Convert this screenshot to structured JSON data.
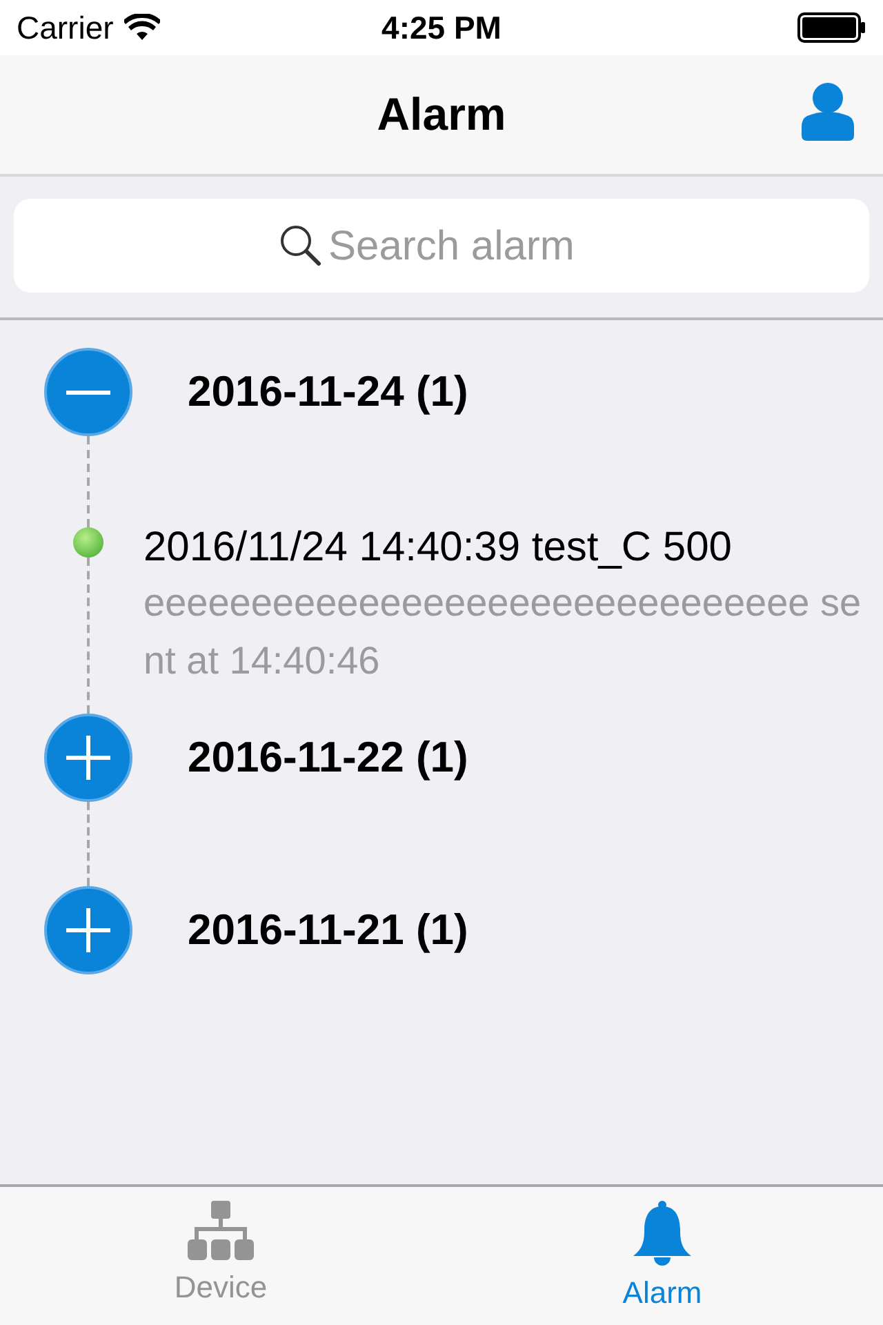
{
  "status_bar": {
    "carrier": "Carrier",
    "time": "4:25 PM"
  },
  "nav": {
    "title": "Alarm"
  },
  "search": {
    "placeholder": "Search alarm"
  },
  "groups": [
    {
      "label": "2016-11-24 (1)",
      "expanded": true,
      "alarms": [
        {
          "title": "2016/11/24 14:40:39 test_C 500",
          "message": "eeeeeeeeeeeeeeeeeeeeeeeeeeeeeee sent at 14:40:46"
        }
      ]
    },
    {
      "label": "2016-11-22 (1)",
      "expanded": false
    },
    {
      "label": "2016-11-21 (1)",
      "expanded": false
    }
  ],
  "tab_bar": [
    {
      "kind": "device",
      "label": "Device",
      "selected": false
    },
    {
      "kind": "alarm",
      "label": "Alarm",
      "selected": true
    }
  ]
}
